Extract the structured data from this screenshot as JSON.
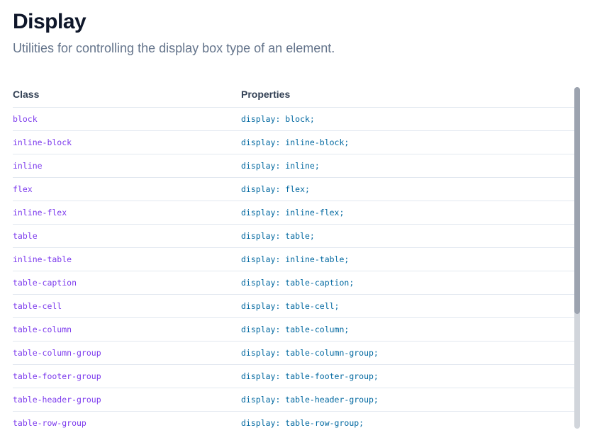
{
  "page": {
    "title": "Display",
    "subtitle": "Utilities for controlling the display box type of an element."
  },
  "table": {
    "headers": {
      "class": "Class",
      "properties": "Properties"
    },
    "rows": [
      {
        "class": "block",
        "properties": "display: block;"
      },
      {
        "class": "inline-block",
        "properties": "display: inline-block;"
      },
      {
        "class": "inline",
        "properties": "display: inline;"
      },
      {
        "class": "flex",
        "properties": "display: flex;"
      },
      {
        "class": "inline-flex",
        "properties": "display: inline-flex;"
      },
      {
        "class": "table",
        "properties": "display: table;"
      },
      {
        "class": "inline-table",
        "properties": "display: inline-table;"
      },
      {
        "class": "table-caption",
        "properties": "display: table-caption;"
      },
      {
        "class": "table-cell",
        "properties": "display: table-cell;"
      },
      {
        "class": "table-column",
        "properties": "display: table-column;"
      },
      {
        "class": "table-column-group",
        "properties": "display: table-column-group;"
      },
      {
        "class": "table-footer-group",
        "properties": "display: table-footer-group;"
      },
      {
        "class": "table-header-group",
        "properties": "display: table-header-group;"
      },
      {
        "class": "table-row-group",
        "properties": "display: table-row-group;"
      }
    ]
  },
  "colors": {
    "class_text": "#7c3aed",
    "property_text": "#0369a1",
    "subtitle": "#64748b"
  }
}
